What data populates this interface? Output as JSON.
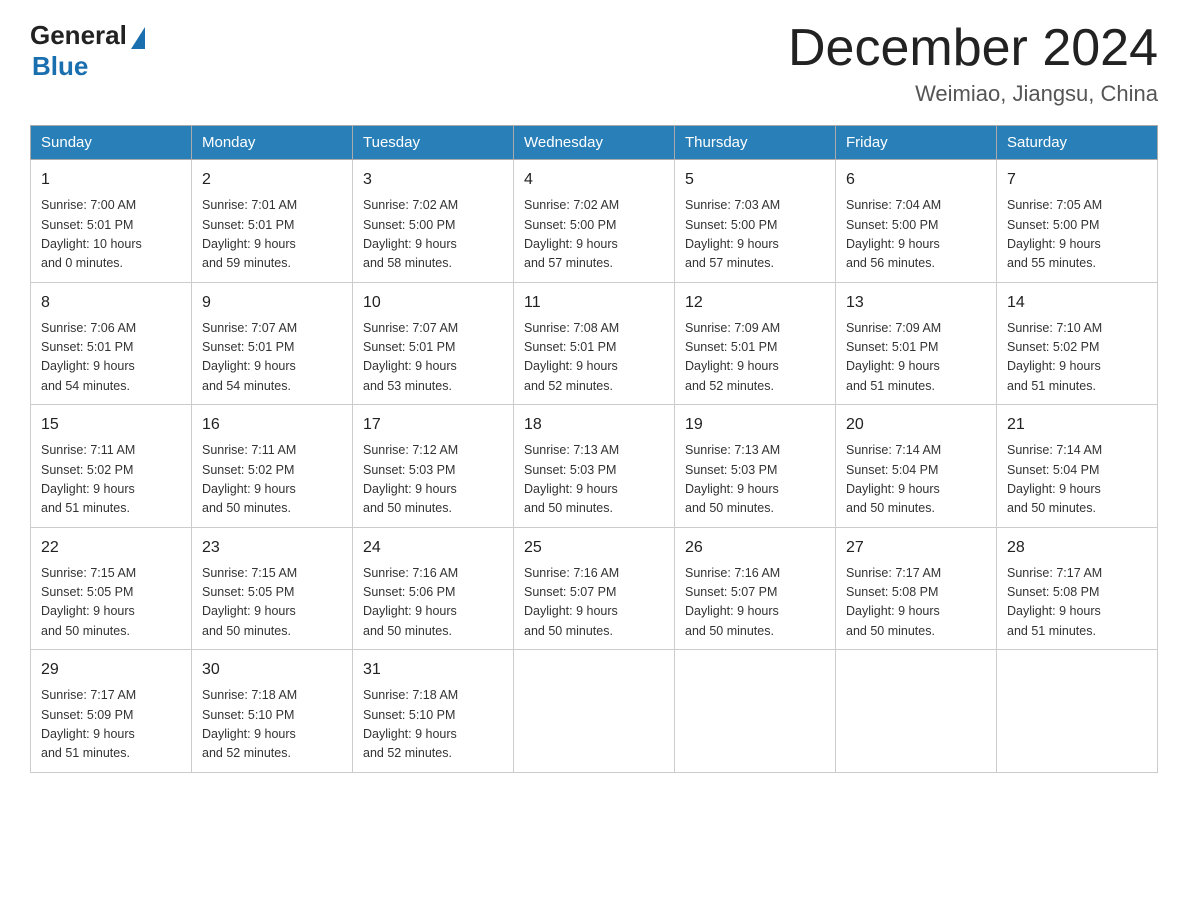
{
  "logo": {
    "general": "General",
    "blue": "Blue"
  },
  "title": {
    "month_year": "December 2024",
    "location": "Weimiao, Jiangsu, China"
  },
  "days_of_week": [
    "Sunday",
    "Monday",
    "Tuesday",
    "Wednesday",
    "Thursday",
    "Friday",
    "Saturday"
  ],
  "weeks": [
    [
      {
        "day": "1",
        "sunrise": "7:00 AM",
        "sunset": "5:01 PM",
        "daylight_hours": "10",
        "daylight_minutes": "0"
      },
      {
        "day": "2",
        "sunrise": "7:01 AM",
        "sunset": "5:01 PM",
        "daylight_hours": "9",
        "daylight_minutes": "59"
      },
      {
        "day": "3",
        "sunrise": "7:02 AM",
        "sunset": "5:00 PM",
        "daylight_hours": "9",
        "daylight_minutes": "58"
      },
      {
        "day": "4",
        "sunrise": "7:02 AM",
        "sunset": "5:00 PM",
        "daylight_hours": "9",
        "daylight_minutes": "57"
      },
      {
        "day": "5",
        "sunrise": "7:03 AM",
        "sunset": "5:00 PM",
        "daylight_hours": "9",
        "daylight_minutes": "57"
      },
      {
        "day": "6",
        "sunrise": "7:04 AM",
        "sunset": "5:00 PM",
        "daylight_hours": "9",
        "daylight_minutes": "56"
      },
      {
        "day": "7",
        "sunrise": "7:05 AM",
        "sunset": "5:00 PM",
        "daylight_hours": "9",
        "daylight_minutes": "55"
      }
    ],
    [
      {
        "day": "8",
        "sunrise": "7:06 AM",
        "sunset": "5:01 PM",
        "daylight_hours": "9",
        "daylight_minutes": "54"
      },
      {
        "day": "9",
        "sunrise": "7:07 AM",
        "sunset": "5:01 PM",
        "daylight_hours": "9",
        "daylight_minutes": "54"
      },
      {
        "day": "10",
        "sunrise": "7:07 AM",
        "sunset": "5:01 PM",
        "daylight_hours": "9",
        "daylight_minutes": "53"
      },
      {
        "day": "11",
        "sunrise": "7:08 AM",
        "sunset": "5:01 PM",
        "daylight_hours": "9",
        "daylight_minutes": "52"
      },
      {
        "day": "12",
        "sunrise": "7:09 AM",
        "sunset": "5:01 PM",
        "daylight_hours": "9",
        "daylight_minutes": "52"
      },
      {
        "day": "13",
        "sunrise": "7:09 AM",
        "sunset": "5:01 PM",
        "daylight_hours": "9",
        "daylight_minutes": "51"
      },
      {
        "day": "14",
        "sunrise": "7:10 AM",
        "sunset": "5:02 PM",
        "daylight_hours": "9",
        "daylight_minutes": "51"
      }
    ],
    [
      {
        "day": "15",
        "sunrise": "7:11 AM",
        "sunset": "5:02 PM",
        "daylight_hours": "9",
        "daylight_minutes": "51"
      },
      {
        "day": "16",
        "sunrise": "7:11 AM",
        "sunset": "5:02 PM",
        "daylight_hours": "9",
        "daylight_minutes": "50"
      },
      {
        "day": "17",
        "sunrise": "7:12 AM",
        "sunset": "5:03 PM",
        "daylight_hours": "9",
        "daylight_minutes": "50"
      },
      {
        "day": "18",
        "sunrise": "7:13 AM",
        "sunset": "5:03 PM",
        "daylight_hours": "9",
        "daylight_minutes": "50"
      },
      {
        "day": "19",
        "sunrise": "7:13 AM",
        "sunset": "5:03 PM",
        "daylight_hours": "9",
        "daylight_minutes": "50"
      },
      {
        "day": "20",
        "sunrise": "7:14 AM",
        "sunset": "5:04 PM",
        "daylight_hours": "9",
        "daylight_minutes": "50"
      },
      {
        "day": "21",
        "sunrise": "7:14 AM",
        "sunset": "5:04 PM",
        "daylight_hours": "9",
        "daylight_minutes": "50"
      }
    ],
    [
      {
        "day": "22",
        "sunrise": "7:15 AM",
        "sunset": "5:05 PM",
        "daylight_hours": "9",
        "daylight_minutes": "50"
      },
      {
        "day": "23",
        "sunrise": "7:15 AM",
        "sunset": "5:05 PM",
        "daylight_hours": "9",
        "daylight_minutes": "50"
      },
      {
        "day": "24",
        "sunrise": "7:16 AM",
        "sunset": "5:06 PM",
        "daylight_hours": "9",
        "daylight_minutes": "50"
      },
      {
        "day": "25",
        "sunrise": "7:16 AM",
        "sunset": "5:07 PM",
        "daylight_hours": "9",
        "daylight_minutes": "50"
      },
      {
        "day": "26",
        "sunrise": "7:16 AM",
        "sunset": "5:07 PM",
        "daylight_hours": "9",
        "daylight_minutes": "50"
      },
      {
        "day": "27",
        "sunrise": "7:17 AM",
        "sunset": "5:08 PM",
        "daylight_hours": "9",
        "daylight_minutes": "50"
      },
      {
        "day": "28",
        "sunrise": "7:17 AM",
        "sunset": "5:08 PM",
        "daylight_hours": "9",
        "daylight_minutes": "51"
      }
    ],
    [
      {
        "day": "29",
        "sunrise": "7:17 AM",
        "sunset": "5:09 PM",
        "daylight_hours": "9",
        "daylight_minutes": "51"
      },
      {
        "day": "30",
        "sunrise": "7:18 AM",
        "sunset": "5:10 PM",
        "daylight_hours": "9",
        "daylight_minutes": "52"
      },
      {
        "day": "31",
        "sunrise": "7:18 AM",
        "sunset": "5:10 PM",
        "daylight_hours": "9",
        "daylight_minutes": "52"
      },
      null,
      null,
      null,
      null
    ]
  ]
}
